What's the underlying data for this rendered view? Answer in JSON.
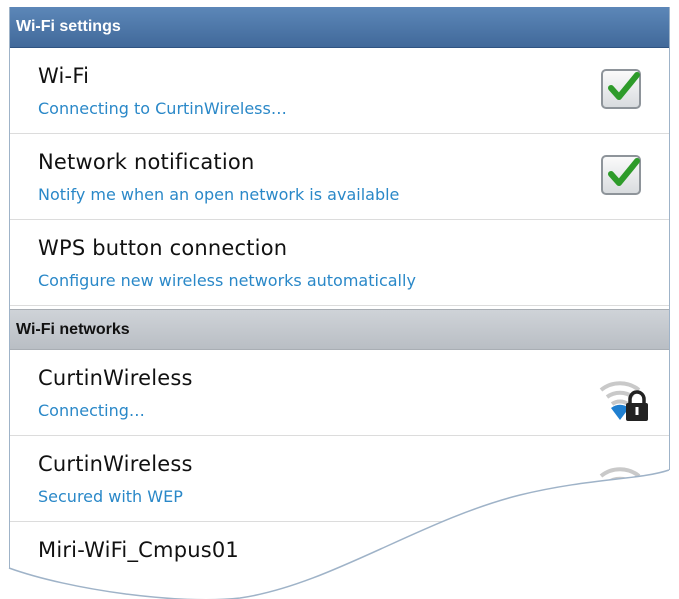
{
  "sections": {
    "settings_header": "Wi-Fi settings",
    "networks_header": "Wi-Fi networks"
  },
  "settings": [
    {
      "title": "Wi-Fi",
      "subtitle": "Connecting to CurtinWireless…",
      "checked": true
    },
    {
      "title": "Network notification",
      "subtitle": "Notify me when an open network is available",
      "checked": true
    },
    {
      "title": "WPS button connection",
      "subtitle": "Configure new wireless networks automatically"
    }
  ],
  "networks": [
    {
      "name": "CurtinWireless",
      "status": "Connecting…",
      "icon": "wifi-lock-icon"
    },
    {
      "name": "CurtinWireless",
      "status": "Secured with WEP",
      "icon": "wifi-lock-icon"
    },
    {
      "name": "Miri-WiFi_Cmpus01"
    }
  ],
  "colors": {
    "header_blue": "#4a74a6",
    "subtitle_blue": "#2a88c8",
    "check_green": "#2e9b2a",
    "signal_active": "#1f7fd0"
  }
}
